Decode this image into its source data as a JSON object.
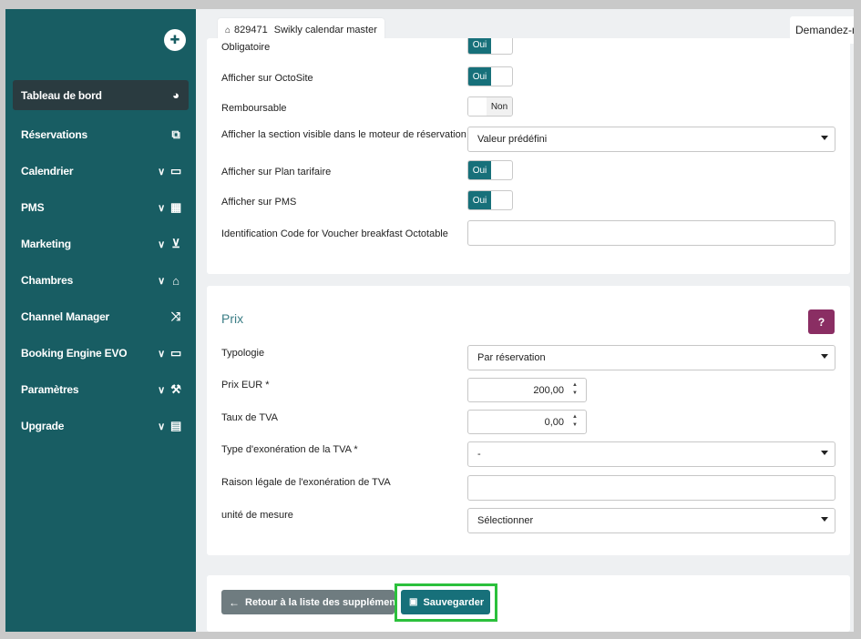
{
  "sidebar": {
    "pin_icon": "pushpin-icon",
    "items": [
      {
        "label": "Tableau de bord",
        "icon": "tachometer-icon",
        "glyph": "◕",
        "chevron": false,
        "active": true
      },
      {
        "label": "Réservations",
        "icon": "tags-icon",
        "glyph": "⧉",
        "chevron": false
      },
      {
        "label": "Calendrier",
        "icon": "calendar-icon",
        "glyph": "▭",
        "chevron": true
      },
      {
        "label": "PMS",
        "icon": "calendar-grid-icon",
        "glyph": "▦",
        "chevron": true
      },
      {
        "label": "Marketing",
        "icon": "cart-icon",
        "glyph": "🛒",
        "chevron": true
      },
      {
        "label": "Chambres",
        "icon": "home-icon",
        "glyph": "⌂",
        "chevron": true
      },
      {
        "label": "Channel Manager",
        "icon": "shuffle-icon",
        "glyph": "⤨",
        "chevron": false
      },
      {
        "label": "Booking Engine EVO",
        "icon": "monitor-icon",
        "glyph": "▭",
        "chevron": true
      },
      {
        "label": "Paramètres",
        "icon": "wrench-icon",
        "glyph": "🔧",
        "chevron": true
      },
      {
        "label": "Upgrade",
        "icon": "credit-card-icon",
        "glyph": "▤",
        "chevron": true
      }
    ]
  },
  "topbar": {
    "property_id": "829471",
    "property_name": "Swikly calendar master",
    "ask_label": "Demandez-m"
  },
  "options_panel": {
    "partial_label": "Obligatoire",
    "rows": [
      {
        "label": "Afficher sur OctoSite",
        "toggle": "Oui"
      },
      {
        "label": "Remboursable",
        "toggle": "Non"
      },
      {
        "label": "Afficher la section visible dans le moteur de réservation",
        "select": "Valeur prédéfini"
      },
      {
        "label": "Afficher sur Plan tarifaire",
        "toggle": "Oui"
      },
      {
        "label": "Afficher sur PMS",
        "toggle": "Oui"
      },
      {
        "label": "Identification Code for Voucher breakfast Octotable",
        "input": ""
      }
    ],
    "partial_toggle": "Oui"
  },
  "price_panel": {
    "title": "Prix",
    "help_label": "?",
    "typologie_label": "Typologie",
    "typologie_value": "Par réservation",
    "prix_label": "Prix EUR *",
    "prix_value": "200,00",
    "tva_label": "Taux de TVA",
    "tva_value": "0,00",
    "exoneration_label": "Type d'exonération de la TVA *",
    "exoneration_value": "-",
    "raison_label": "Raison légale de l'exonération de TVA",
    "raison_value": "",
    "unite_label": "unité de mesure",
    "unite_value": "Sélectionner"
  },
  "actions": {
    "back_label": "Retour à la liste des suppléments",
    "save_label": "Sauvegarder"
  },
  "colors": {
    "sidebar": "#185d63",
    "accent": "#17707a",
    "help": "#8a2e63",
    "highlight": "#2bc03c"
  }
}
